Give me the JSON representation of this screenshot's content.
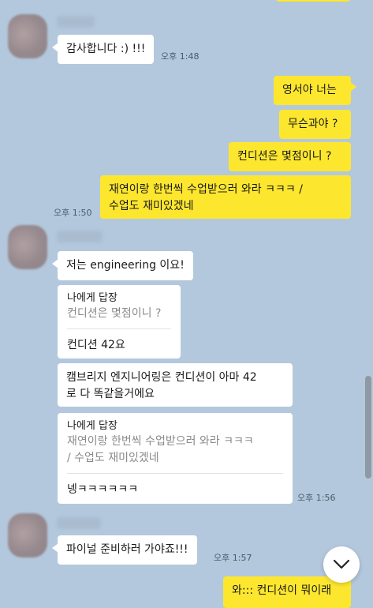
{
  "messages": [
    {
      "id": "m1",
      "side": "left",
      "text": "감사합니다 :) !!!",
      "time": "오후 1:48"
    },
    {
      "id": "m2",
      "side": "right",
      "text": "영서야 너는"
    },
    {
      "id": "m3",
      "side": "right",
      "text": "무슨과야 ?"
    },
    {
      "id": "m4",
      "side": "right",
      "text": "컨디션은 몇점이니 ?"
    },
    {
      "id": "m5",
      "side": "right",
      "text": "재연이랑 한번씩 수업받으러 와라 ㅋㅋㅋ /\n수업도 재미있겠네",
      "time": "오후 1:50"
    },
    {
      "id": "m6",
      "side": "left",
      "text": "저는 engineering 이요!"
    },
    {
      "id": "m7",
      "side": "left",
      "type": "reply",
      "label": "나에게 답장",
      "quote": "컨디션은 몇점이니 ?",
      "answer": "컨디션 42요"
    },
    {
      "id": "m8",
      "side": "left",
      "text": "캠브리지 엔지니어링은 컨디션이 아마 42\n로 다 똑같을거에요"
    },
    {
      "id": "m9",
      "side": "left",
      "type": "reply",
      "label": "나에게 답장",
      "quote": "재연이랑 한번씩 수업받으러 와라 ㅋㅋㅋ\n/ 수업도 재미있겠네",
      "answer": "넹ㅋㅋㅋㅋㅋㅋ",
      "time": "오후 1:56"
    },
    {
      "id": "m10",
      "side": "left",
      "text": "파이널 준비하러 가야죠!!!",
      "time": "오후 1:57"
    },
    {
      "id": "m11",
      "side": "right",
      "text": "와::: 컨디션이 뭐이래"
    }
  ],
  "icons": {
    "scroll_down": "chevron-down-icon"
  }
}
